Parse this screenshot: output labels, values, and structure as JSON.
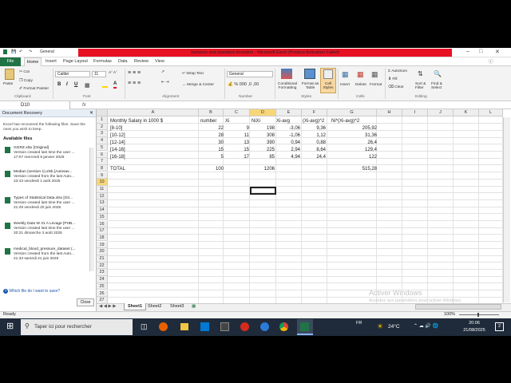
{
  "window": {
    "title": "Variance and standard deviation  -  Microsoft Excel (Product Activation Failed)",
    "quick_access_font": "General"
  },
  "menu_tabs": [
    "File",
    "Home",
    "Insert",
    "Page Layout",
    "Formulas",
    "Data",
    "Review",
    "View"
  ],
  "ribbon": {
    "clipboard": {
      "paste": "Paste",
      "cut": "Cut",
      "copy": "Copy",
      "format_painter": "Format Painter",
      "label": "Clipboard"
    },
    "font": {
      "name": "Calibri",
      "size": "11",
      "label": "Font"
    },
    "alignment": {
      "wrap": "Wrap Text",
      "merge": "Merge & Center",
      "label": "Alignment"
    },
    "number": {
      "format": "General",
      "label": "Number"
    },
    "styles": {
      "conditional": "Conditional Formatting",
      "format_table": "Format as Table",
      "cell_styles": "Cell Styles",
      "label": "Styles"
    },
    "cells": {
      "insert": "Insert",
      "delete": "Delete",
      "format": "Format",
      "label": "Cells"
    },
    "editing": {
      "autosum": "AutoSum",
      "fill": "Fill",
      "clear": "Clear",
      "sort": "Sort & Filter",
      "find": "Find & Select",
      "label": "Editing"
    }
  },
  "formula_bar": {
    "cell_ref": "D10",
    "fx": "fx",
    "formula": ""
  },
  "recovery": {
    "title": "Document Recovery",
    "description": "Excel has recovered the following files.  Save the ones you wish to keep.",
    "available": "Available files",
    "files": [
      {
        "name": "GGRZ.xlsx  [Original]",
        "line2": "Version created last time the user ...",
        "line3": "17:07 mercredi 8 janvier 2025"
      },
      {
        "name": "Median (version 1).xlsb  [Autosav...",
        "line2": "Version created from the last Auto...",
        "line3": "23:43 vendredi 1 août 2025"
      },
      {
        "name": "Types of Statistical Data.xlsx  [Ori...",
        "line2": "Version created last time the user ...",
        "line3": "21:29 vendredi 20 juin 2025"
      },
      {
        "name": "Weekly Data W 31 A Levage [PHB...",
        "line2": "Version created last time the user ...",
        "line3": "20:21 dimanche 3 août 2025"
      },
      {
        "name": "medical_blood_pressure_dataset (...",
        "line2": "Version created from the last Auto...",
        "line3": "21:33 samedi 21 juin 2025"
      }
    ],
    "help_link": "Which file do I want to save?",
    "close": "Close"
  },
  "sheet": {
    "columns": [
      "A",
      "B",
      "C",
      "D",
      "E",
      "F",
      "G",
      "H",
      "I",
      "J",
      "K",
      "L"
    ],
    "rows": [
      "1",
      "2",
      "3",
      "4",
      "5",
      "6",
      "7",
      "8",
      "9",
      "10",
      "11",
      "12",
      "13",
      "14",
      "15",
      "16",
      "17",
      "18",
      "19",
      "20",
      "21",
      "22",
      "23",
      "24",
      "25",
      "26",
      "27"
    ],
    "r1": {
      "a": "Monthly Salary in 1000 $",
      "b": "number",
      "c": "Xi",
      "d": "NiXi",
      "e": "Xi-avg",
      "f": "(Xi-avg)^2",
      "g": "Ni*(Xi-avg)^2"
    },
    "data": [
      {
        "a": "[8-10]",
        "b": "22",
        "c": "9",
        "d": "198",
        "e": "-3,06",
        "f": "9,36",
        "g": "205,92"
      },
      {
        "a": "[10-12]",
        "b": "28",
        "c": "11",
        "d": "308",
        "e": "-1,06",
        "f": "1,12",
        "g": "31,36"
      },
      {
        "a": "[12-14]",
        "b": "30",
        "c": "13",
        "d": "390",
        "e": "0,94",
        "f": "0,88",
        "g": "26,4"
      },
      {
        "a": "[14-16]",
        "b": "15",
        "c": "15",
        "d": "225",
        "e": "2,94",
        "f": "8,64",
        "g": "129,4"
      },
      {
        "a": "[16-18]",
        "b": "5",
        "c": "17",
        "d": "85",
        "e": "4,94",
        "f": "24,4",
        "g": "122"
      }
    ],
    "total": {
      "a": "TOTAL",
      "b": "100",
      "d": "1206",
      "g": "515,28"
    },
    "tabs": [
      "Sheet1",
      "Sheet2",
      "Sheet3"
    ],
    "watermark_title": "Activer Windows",
    "watermark_sub": "Accédez aux paramètres pour activer Windows."
  },
  "status": {
    "ready": "Ready",
    "zoom": "100%"
  },
  "taskbar": {
    "search": "Taper ici pour rechercher",
    "weather": "24°C",
    "lang": "FR",
    "time": "20:06",
    "date": "21/08/2025",
    "notif": "2"
  },
  "colors": {
    "excel_green": "#217346",
    "title_red": "#e81123",
    "taskbar": "#1f2b3a"
  }
}
